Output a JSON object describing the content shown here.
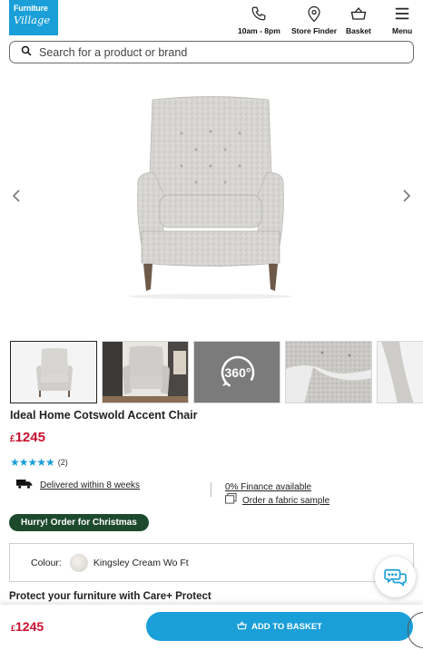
{
  "header": {
    "logo_line1": "Furniture",
    "logo_line2": "Village",
    "hours_label": "10am - 8pm",
    "store_finder_label": "Store Finder",
    "basket_label": "Basket",
    "menu_label": "Menu"
  },
  "search": {
    "placeholder": "Search for a product or brand"
  },
  "gallery": {
    "thumb_360_label": "360°",
    "active_index": 0,
    "thumb_count_visible": 5
  },
  "product": {
    "title": "Ideal Home Cotswold Accent Chair",
    "currency": "£",
    "price": "1245",
    "rating_stars": 5,
    "rating_count": "(2)",
    "delivery_text": "Delivered within 8 weeks",
    "finance_text": "0% Finance available",
    "sample_text": "Order a fabric sample",
    "badge": "Hurry! Order for Christmas",
    "colour_label": "Colour:",
    "colour_value": "Kingsley Cream Wo Ft",
    "protect_title": "Protect your furniture with Care+ Protect"
  },
  "bottom_bar": {
    "currency": "£",
    "price": "1245",
    "add_button_label": "ADD TO BASKET"
  },
  "colors": {
    "brand_blue": "#1a9fd8",
    "price_red": "#c8102e",
    "badge_green": "#1d4a2c"
  }
}
